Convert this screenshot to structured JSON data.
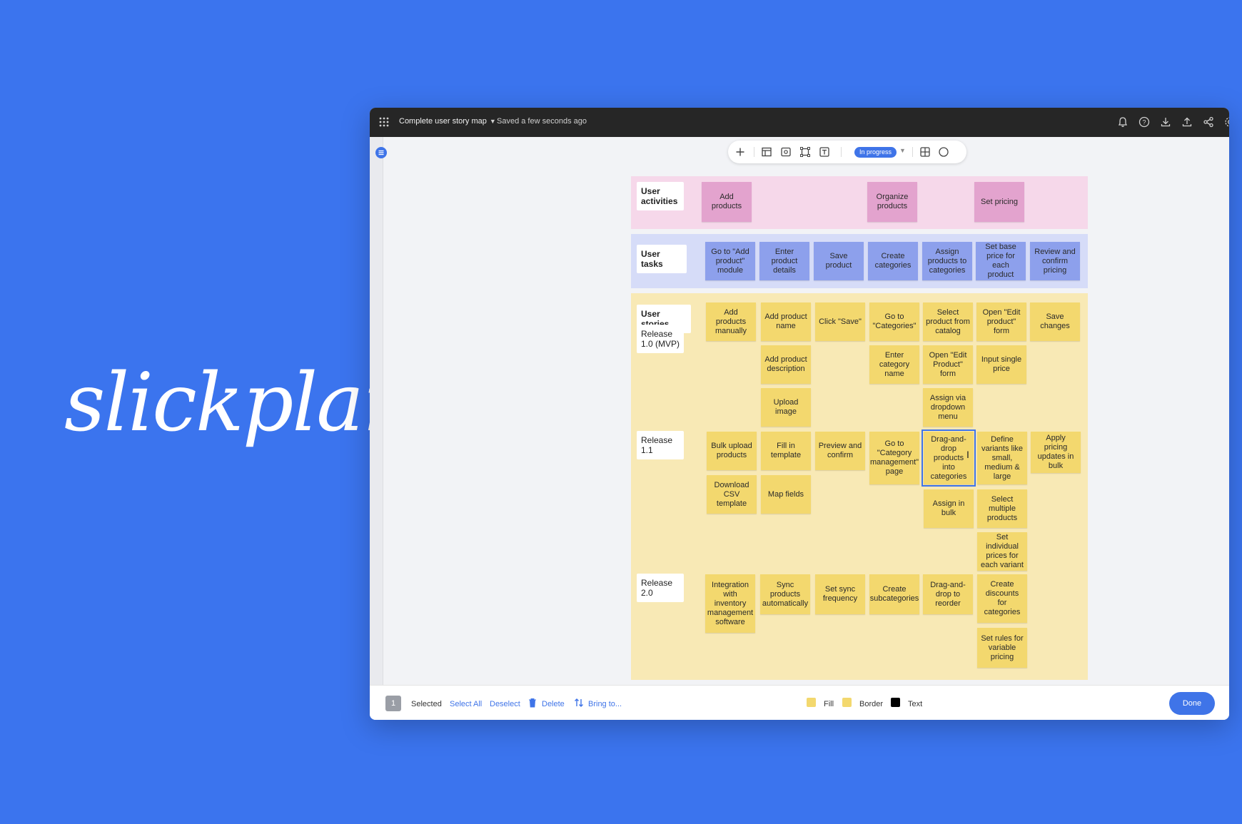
{
  "brand": {
    "logo_text": "slickplan"
  },
  "topbar": {
    "project_title": "Complete user story map",
    "saved_status": "Saved a few seconds ago",
    "icons": [
      "bell-icon",
      "help-icon",
      "download-icon",
      "upload-icon",
      "share-icon",
      "settings-icon"
    ]
  },
  "toolbar": {
    "status_label": "In progress",
    "status_color": "#3f74e8",
    "icons": [
      "plus-icon",
      "layout-icon",
      "image-icon",
      "frame-icon",
      "text-icon",
      "table-icon",
      "comment-icon"
    ]
  },
  "map": {
    "activities_label": "User activities",
    "tasks_label": "User tasks",
    "stories_label": "User stories",
    "release_1_0_label": "Release 1.0 (MVP)",
    "release_1_1_label": "Release 1.1",
    "release_2_0_label": "Release 2.0",
    "activities": [
      "Add products",
      "Organize products",
      "Set pricing"
    ],
    "tasks": [
      "Go to \"Add product\" module",
      "Enter product details",
      "Save product",
      "Create categories",
      "Assign products to categories",
      "Set base price for each product",
      "Review and confirm pricing"
    ],
    "release_1_0": {
      "row1": [
        "Add products manually",
        "Add product name",
        "Click \"Save\"",
        "Go to \"Categories\"",
        "Select product from catalog",
        "Open \"Edit product\" form",
        "Save changes"
      ],
      "row2": [
        "Add product description",
        "Enter category name",
        "Open \"Edit Product\" form",
        "Input single price"
      ],
      "row3": [
        "Upload image",
        "Assign via dropdown menu"
      ]
    },
    "release_1_1": {
      "row1": [
        "Bulk upload products",
        "Fill in template",
        "Preview and confirm",
        "Go to \"Category management\" page",
        "Drag-and-drop products into categories",
        "Define variants like small, medium & large",
        "Apply pricing updates in bulk"
      ],
      "row2": [
        "Download CSV template",
        "Map fields",
        "Assign in bulk",
        "Select multiple products"
      ],
      "row3": [
        "Set individual prices for each variant"
      ]
    },
    "release_2_0": {
      "row1": [
        "Integration with inventory management software",
        "Sync products automatically",
        "Set sync frequency",
        "Create subcategories",
        "Drag-and-drop to reorder",
        "Create discounts for categories"
      ],
      "row2": [
        "Set rules for variable pricing"
      ]
    },
    "colors": {
      "activity": "#e3a3ce",
      "task": "#8da0ec",
      "story": "#f3d86e"
    }
  },
  "bottombar": {
    "selected_count": "1",
    "selected_label": "Selected",
    "select_all": "Select All",
    "deselect": "Deselect",
    "delete": "Delete",
    "bring_to": "Bring to...",
    "fill_label": "Fill",
    "border_label": "Border",
    "text_label": "Text",
    "fill_color": "#f3d86e",
    "border_color": "#f3d86e",
    "text_color": "#000000",
    "done": "Done"
  }
}
